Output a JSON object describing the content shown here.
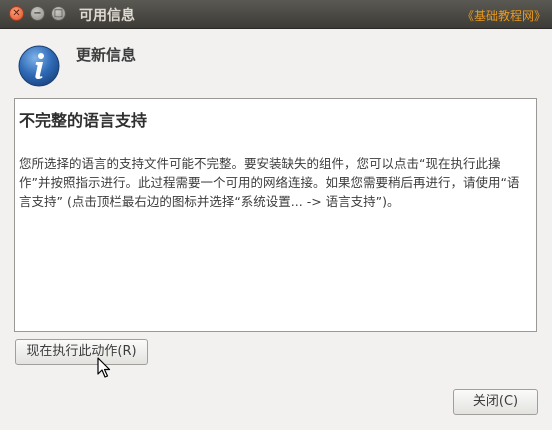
{
  "window": {
    "title": "可用信息",
    "watermark": "《基础教程网》",
    "close_glyph": "✕",
    "min_glyph": "−",
    "max_glyph": "□"
  },
  "header": {
    "title": "更新信息",
    "icon": "info-icon",
    "icon_color": "#2a5fa8"
  },
  "panel": {
    "title": "不完整的语言支持",
    "body": "您所选择的语言的支持文件可能不完整。要安装缺失的组件，您可以点击“现在执行此操作”并按照指示进行。此过程需要一个可用的网络连接。如果您需要稍后再进行，请使用“语言支持” (点击顶栏最右边的图标并选择“系统设置... -> 语言支持”)。"
  },
  "buttons": {
    "run_now": "现在执行此动作(R)",
    "close": "关闭(C)"
  },
  "colors": {
    "titlebar": "#3c3b37",
    "close_button": "#e2502a",
    "watermark": "#e99a20",
    "window_bg": "#f2f1f0"
  }
}
